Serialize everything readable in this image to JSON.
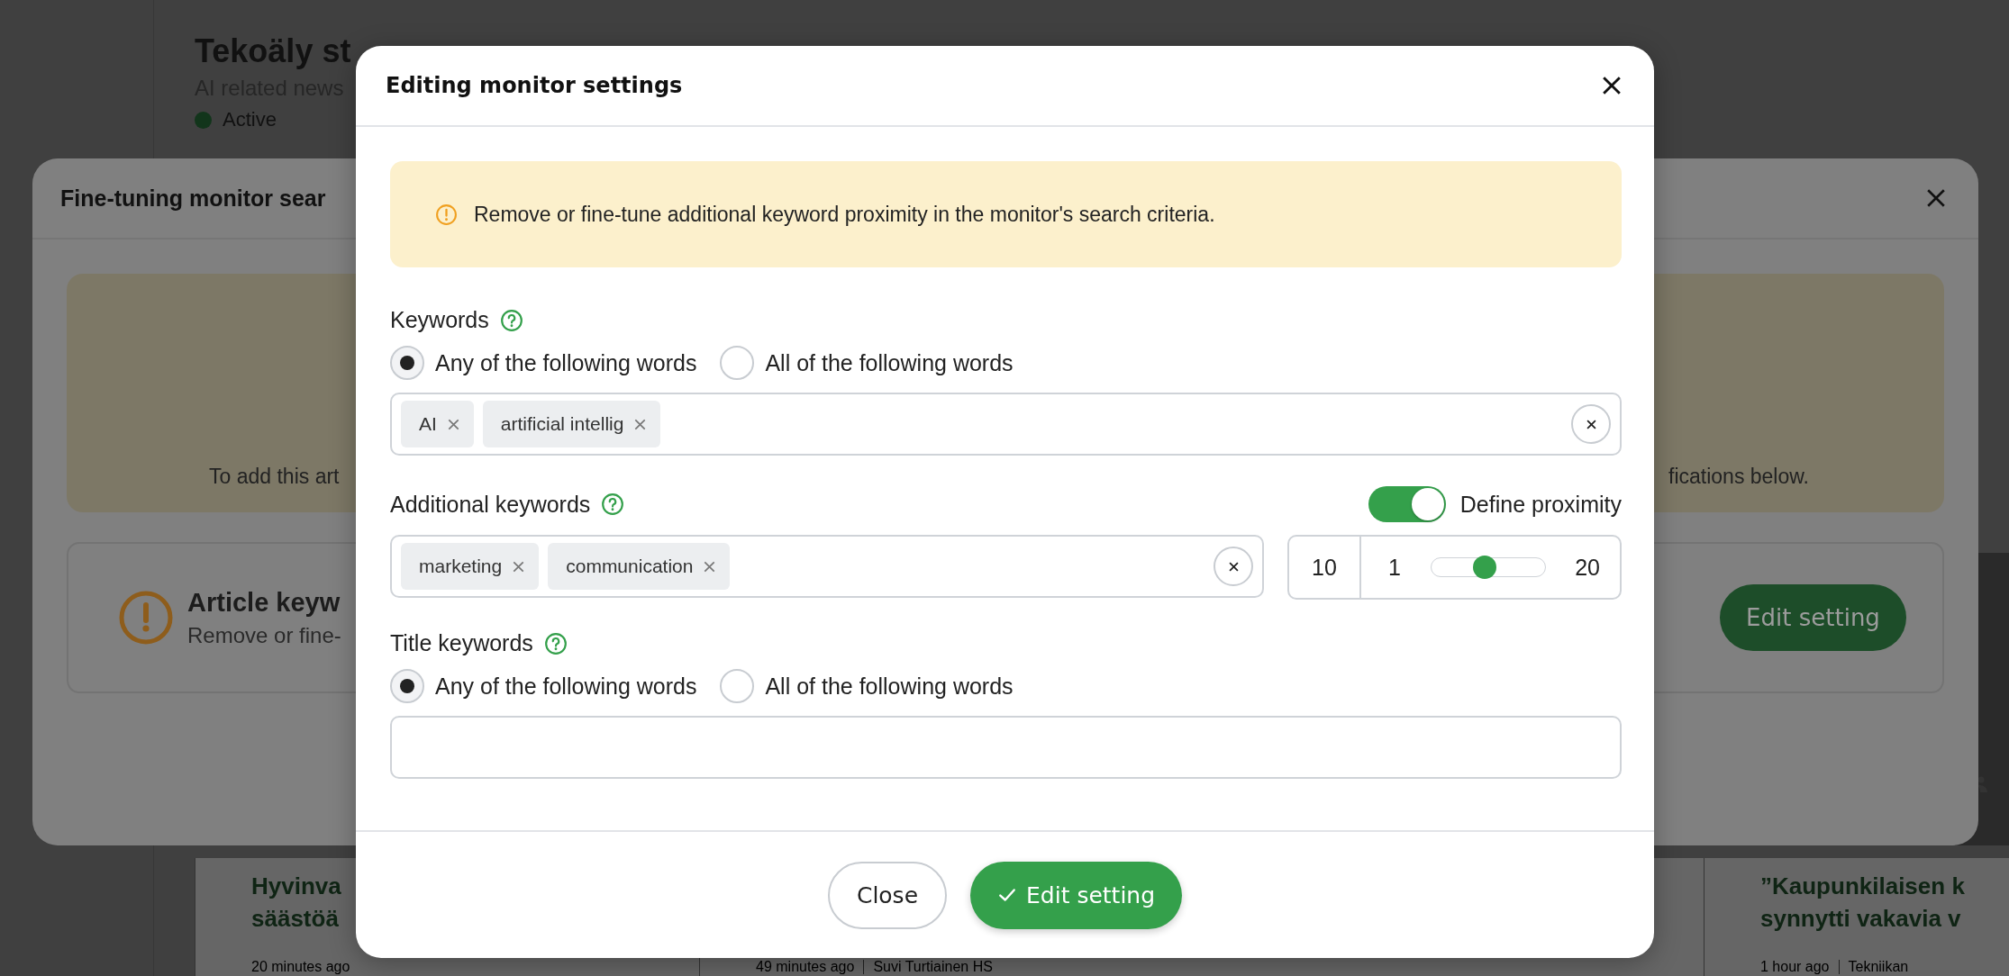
{
  "page": {
    "title": "Tekoäly st",
    "subtitle": "AI related news",
    "status": "Active",
    "articles": [
      {
        "title_lines": [
          "Hyvinva",
          "säästöä"
        ],
        "meta": [
          "20 minutes ago"
        ]
      },
      {
        "meta": [
          "49 minutes ago",
          "Suvi Turtiainen HS"
        ]
      },
      {
        "title_lines": [
          "”Kaupunkilaisen k",
          "synnytti vakavia v"
        ],
        "meta": [
          "1 hour ago",
          "Tekniikan"
        ]
      }
    ]
  },
  "background_dialog": {
    "title": "Fine-tuning monitor sear",
    "notice_parts": [
      "To add this art",
      "fications below."
    ],
    "issue": {
      "title": "Article keyw",
      "description": "Remove or fine-",
      "button": "Edit setting"
    }
  },
  "dialog": {
    "title": "Editing monitor settings",
    "alert": "Remove or fine-tune additional keyword proximity in the monitor's search criteria.",
    "sections": [
      {
        "kind": "keywords",
        "label": "Keywords",
        "options": [
          {
            "label": "Any of the following words",
            "selected": true
          },
          {
            "label": "All of the following words",
            "selected": false
          }
        ],
        "tags": [
          "AI",
          "artificial intellig"
        ]
      },
      {
        "kind": "additional",
        "label": "Additional keywords",
        "tags": [
          "marketing",
          "communication"
        ],
        "proximity": {
          "label": "Define proximity",
          "on": true,
          "value": "10",
          "min": "1",
          "max": "20",
          "level": 0.47
        }
      },
      {
        "kind": "keywords",
        "label": "Title keywords",
        "options": [
          {
            "label": "Any of the following words",
            "selected": true
          },
          {
            "label": "All of the following words",
            "selected": false
          }
        ]
      }
    ],
    "buttons": [
      {
        "kind": "secondary",
        "label": "Close"
      },
      {
        "kind": "primary",
        "label": "Edit setting"
      }
    ]
  }
}
